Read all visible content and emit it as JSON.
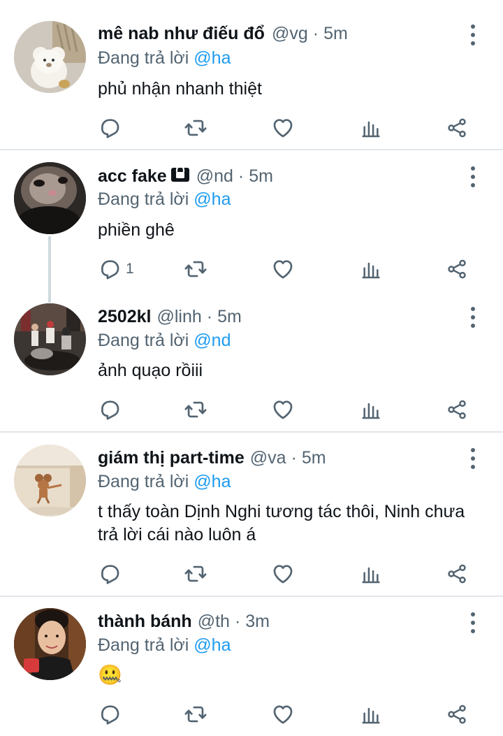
{
  "reply_prefix": "Đang trả lời",
  "separator": "·",
  "tweets": [
    {
      "name": "mê nab như điếu đổ",
      "handle": "@vg",
      "time": "5m",
      "reply_to": "@ha",
      "text": "phủ nhận nhanh thiệt",
      "reply_count": "",
      "locked": false,
      "avatar": "teddy-bear-toy-avatar"
    },
    {
      "name": "acc fake",
      "handle": "@nd",
      "time": "5m",
      "reply_to": "@ha",
      "text": "phiền ghê",
      "reply_count": "1",
      "locked": true,
      "avatar": "blurry-cat-avatar"
    },
    {
      "name": "2502kl",
      "handle": "@linh",
      "time": "5m",
      "reply_to": "@nd",
      "text": "ảnh quạo rồiii",
      "reply_count": "",
      "locked": false,
      "avatar": "street-photo-avatar"
    },
    {
      "name": "giám thị part-time",
      "handle": "@va",
      "time": "5m",
      "reply_to": "@ha",
      "text": "t thấy toàn Dịnh Nghi tương tác thôi, Ninh chưa trả lời cái nào luôn á",
      "reply_count": "",
      "locked": false,
      "avatar": "cartoon-mouse-avatar"
    },
    {
      "name": "thành bánh",
      "handle": "@th",
      "time": "3m",
      "reply_to": "@ha",
      "text": "🤐",
      "reply_count": "",
      "locked": false,
      "avatar": "man-selfie-avatar"
    }
  ],
  "colors": {
    "text": "#0f1419",
    "secondary": "#536471",
    "link": "#1d9bf0",
    "divider": "#e1e6ea",
    "thread_line": "#cfd9de"
  },
  "icons": [
    "reply-icon",
    "retweet-icon",
    "like-icon",
    "stats-icon",
    "share-icon",
    "more-icon",
    "lock-icon"
  ]
}
